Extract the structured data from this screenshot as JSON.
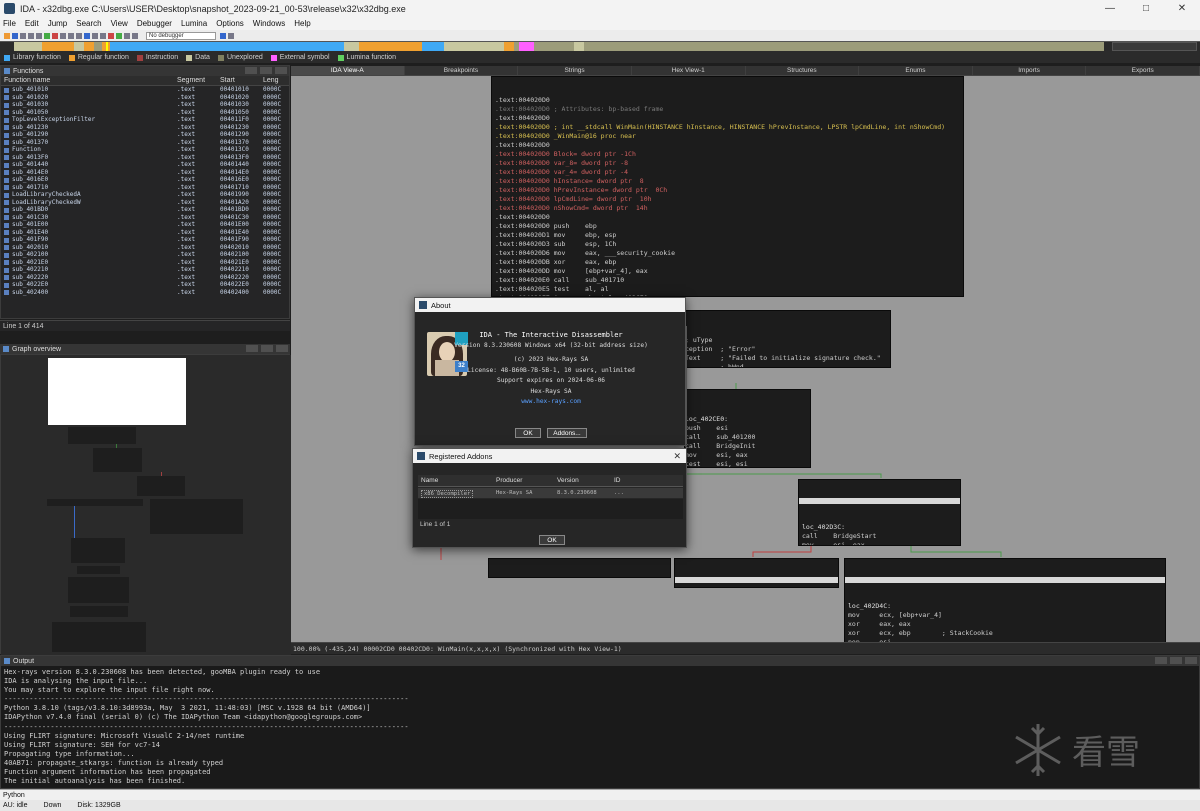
{
  "window": {
    "title": "IDA - x32dbg.exe C:\\Users\\USER\\Desktop\\snapshot_2023-09-21_00-53\\release\\x32\\x32dbg.exe"
  },
  "menu": [
    "File",
    "Edit",
    "Jump",
    "Search",
    "View",
    "Debugger",
    "Lumina",
    "Options",
    "Windows",
    "Help"
  ],
  "toolbar": {
    "debugger": "No debugger"
  },
  "legend": [
    {
      "label": "Library function",
      "color": "#3fa9f5"
    },
    {
      "label": "Regular function",
      "color": "#f0a030"
    },
    {
      "label": "Instruction",
      "color": "#a04040"
    },
    {
      "label": "Data",
      "color": "#c8c8a0"
    },
    {
      "label": "Unexplored",
      "color": "#808060"
    },
    {
      "label": "External symbol",
      "color": "#ff60ff"
    },
    {
      "label": "Lumina function",
      "color": "#60d060"
    }
  ],
  "functions": {
    "title": "Functions",
    "columns": [
      "Function name",
      "Segment",
      "Start",
      "Leng"
    ],
    "rows": [
      [
        "sub_401010",
        ".text",
        "00401010",
        "0000C"
      ],
      [
        "sub_401020",
        ".text",
        "00401020",
        "0000C"
      ],
      [
        "sub_401030",
        ".text",
        "00401030",
        "0000C"
      ],
      [
        "sub_401050",
        ".text",
        "00401050",
        "0000C"
      ],
      [
        "TopLevelExceptionFilter",
        ".text",
        "004011F0",
        "0000C"
      ],
      [
        "sub_401230",
        ".text",
        "00401230",
        "0000C"
      ],
      [
        "sub_401290",
        ".text",
        "00401290",
        "0000C"
      ],
      [
        "sub_401370",
        ".text",
        "00401370",
        "0000C"
      ],
      [
        "Function",
        ".text",
        "004013C0",
        "0000C"
      ],
      [
        "sub_4013F0",
        ".text",
        "004013F0",
        "0000C"
      ],
      [
        "sub_401440",
        ".text",
        "00401440",
        "0000C"
      ],
      [
        "sub_4014E0",
        ".text",
        "004014E0",
        "0000C"
      ],
      [
        "sub_4016E0",
        ".text",
        "004016E0",
        "0000C"
      ],
      [
        "sub_401710",
        ".text",
        "00401710",
        "0000C"
      ],
      [
        "LoadLibraryCheckedA",
        ".text",
        "00401990",
        "0000C"
      ],
      [
        "LoadLibraryCheckedW",
        ".text",
        "00401A20",
        "0000C"
      ],
      [
        "sub_401BD0",
        ".text",
        "00401BD0",
        "0000C"
      ],
      [
        "sub_401C30",
        ".text",
        "00401C30",
        "0000C"
      ],
      [
        "sub_401E00",
        ".text",
        "00401E00",
        "0000C"
      ],
      [
        "sub_401E40",
        ".text",
        "00401E40",
        "0000C"
      ],
      [
        "sub_401F90",
        ".text",
        "00401F90",
        "0000C"
      ],
      [
        "sub_402010",
        ".text",
        "00402010",
        "0000C"
      ],
      [
        "sub_402100",
        ".text",
        "00402100",
        "0000C"
      ],
      [
        "sub_4021E0",
        ".text",
        "004021E0",
        "0000C"
      ],
      [
        "sub_402210",
        ".text",
        "00402210",
        "0000C"
      ],
      [
        "sub_402220",
        ".text",
        "00402220",
        "0000C"
      ],
      [
        "sub_4022E0",
        ".text",
        "004022E0",
        "0000C"
      ],
      [
        "sub_402400",
        ".text",
        "00402400",
        "0000C"
      ]
    ],
    "footer": "Line 1 of 414"
  },
  "graph_overview": {
    "title": "Graph overview"
  },
  "tabs": [
    "IDA View-A",
    "Breakpoints",
    "Strings",
    "Hex View-1",
    "Structures",
    "Enums",
    "Imports",
    "Exports"
  ],
  "disasm_main": [
    ".text:004020D0",
    ".text:004020D0 ; Attributes: bp-based frame",
    ".text:004020D0",
    ".text:004020D0 ; int __stdcall WinMain(HINSTANCE hInstance, HINSTANCE hPrevInstance, LPSTR lpCmdLine, int nShowCmd)",
    ".text:004020D0 _WinMain@16 proc near",
    ".text:004020D0",
    ".text:004020D0 Block= dword ptr -1Ch",
    ".text:004020D0 var_8= dword ptr -8",
    ".text:004020D0 var_4= dword ptr -4",
    ".text:004020D0 hInstance= dword ptr  8",
    ".text:004020D0 hPrevInstance= dword ptr  0Ch",
    ".text:004020D0 lpCmdLine= dword ptr  10h",
    ".text:004020D0 nShowCmd= dword ptr  14h",
    ".text:004020D0",
    ".text:004020D0 push    ebp",
    ".text:004020D1 mov     ebp, esp",
    ".text:004020D3 sub     esp, 1Ch",
    ".text:004020D6 mov     eax, ___security_cookie",
    ".text:004020DB xor     eax, ebp",
    ".text:004020DD mov     [ebp+var_4], eax",
    ".text:004020E0 call    sub_401710",
    ".text:004020E5 test    al, al",
    ".text:004020E7 jnz     short loc_402CE0"
  ],
  "disasm_right": [
    "; uType",
    "ception  ; \"Error\"",
    "Text     ; \"Failed to initialize signature check.\"",
    "         ; hWnd",
    "oxA"
  ],
  "block_ce0": [
    "loc_402CE0:",
    "push    esi",
    "call    sub_401200",
    "call    BridgeInit",
    "mov     esi, eax",
    "test    esi, esi",
    "jz      short loc_402D3C"
  ],
  "block_d3c": [
    "loc_402D3C:",
    "call    BridgeStart",
    "mov     esi, eax",
    "test    esi, esi",
    "jz      short loc_402D4C"
  ],
  "block_d4c": [
    "loc_402D4C:",
    "mov     ecx, [ebp+var_4]",
    "xor     eax, eax",
    "xor     ecx, ebp        ; StackCookie",
    "pop     esi",
    "call    @__security_check_cookie@4 ; __security_check_cookie(x)",
    "mov     esp, ebp"
  ],
  "block_small1": [
    "push    offset Text  ; \"\"",
    "jmp     short loc_402CF4"
  ],
  "block_small2": [
    "push    7FFh  ; \"s\"",
    "; u32D"
  ],
  "status_line": "100.00% (-435,24) 00002CD0 00402CD0: WinMain(x,x,x,x) (Synchronized with Hex View-1)",
  "output": {
    "title": "Output",
    "lines": [
      "Hex-rays version 8.3.0.230608 has been detected, gooMBA plugin ready to use",
      "IDA is analysing the input file...",
      "You may start to explore the input file right now.",
      "------------------------------------------------------------------------------------------------",
      "Python 3.8.10 (tags/v3.8.10:3d8993a, May  3 2021, 11:48:03) [MSC v.1928 64 bit (AMD64)]",
      "IDAPython v7.4.0 final (serial 0) (c) The IDAPython Team <idapython@googlegroups.com>",
      "------------------------------------------------------------------------------------------------",
      "Using FLIRT signature: Microsoft VisualC 2-14/net runtime",
      "Using FLIRT signature: SEH for vc7-14",
      "Propagating type information...",
      "40AB71: propagate_stkargs: function is already typed",
      "Function argument information has been propagated",
      "The initial autoanalysis has been finished."
    ]
  },
  "python_prompt": "Python",
  "status_bar": [
    "AU:  idle",
    "Down",
    "Disk: 1329GB"
  ],
  "about": {
    "title": "About",
    "heading": "IDA - The Interactive Disassembler",
    "version": "Version 8.3.230608 Windows x64 (32-bit address size)",
    "copyright": "(c) 2023 Hex-Rays SA",
    "license": "License: 48-B60B-7B-5B-1, 10 users, unlimited",
    "support": "Support expires on 2024-06-06",
    "company": "Hex-Rays SA",
    "url": "www.hex-rays.com",
    "ok": "OK",
    "addons": "Addons...",
    "badge": "32"
  },
  "registered": {
    "title": "Registered Addons",
    "columns": [
      "Name",
      "Producer",
      "Version",
      "ID"
    ],
    "row": [
      "x86 Decompiler",
      "Hex-Rays SA",
      "8.3.0.230608",
      "..."
    ],
    "footer": "Line 1 of 1",
    "ok": "OK"
  },
  "watermark": "看雪"
}
